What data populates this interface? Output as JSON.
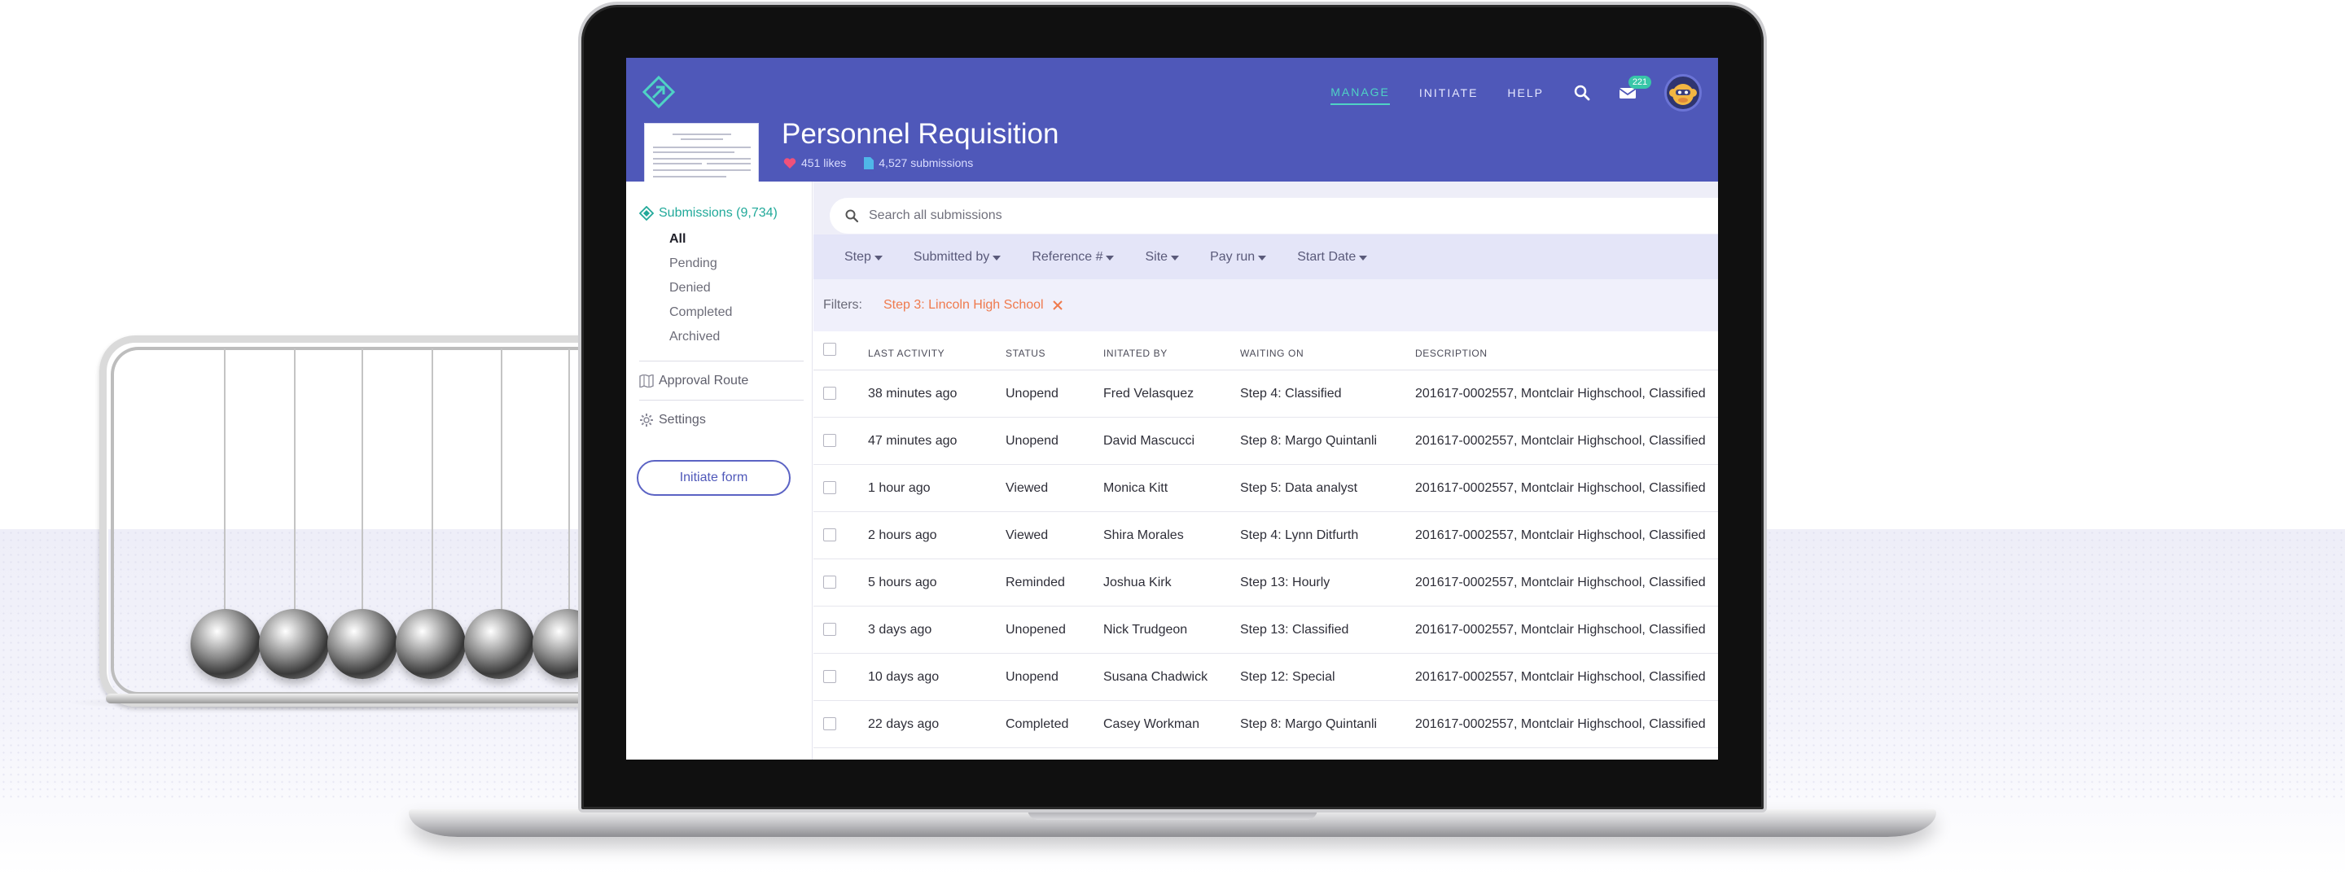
{
  "app": {
    "nav": {
      "manage": "MANAGE",
      "initiate": "INITIATE",
      "help": "HELP"
    },
    "mail_count": "221",
    "accent": "#4f58b9",
    "teal": "#21a99a",
    "filter_color": "#ef7a4d"
  },
  "form": {
    "title": "Personnel Requisition",
    "likes": "451 likes",
    "submissions": "4,527 submissions"
  },
  "sidebar": {
    "heading": "Submissions (9,734)",
    "subitems": [
      "All",
      "Pending",
      "Denied",
      "Completed",
      "Archived"
    ],
    "approval_route": "Approval Route",
    "settings": "Settings",
    "initiate_button": "Initiate form"
  },
  "search": {
    "placeholder": "Search all submissions"
  },
  "dropdowns": [
    "Step",
    "Submitted by",
    "Reference #",
    "Site",
    "Pay run",
    "Start Date"
  ],
  "filters": {
    "label": "Filters:",
    "active": "Step 3: Lincoln High School"
  },
  "table": {
    "headers": [
      "LAST ACTIVITY",
      "STATUS",
      "INITATED BY",
      "WAITING ON",
      "DESCRIPTION"
    ],
    "rows": [
      [
        "38 minutes ago",
        "Unopend",
        "Fred Velasquez",
        "Step 4: Classified",
        "201617-0002557, Montclair Highschool, Classified"
      ],
      [
        "47 minutes ago",
        "Unopend",
        "David Mascucci",
        "Step 8: Margo Quintanli",
        "201617-0002557, Montclair Highschool, Classified"
      ],
      [
        "1 hour ago",
        "Viewed",
        "Monica Kitt",
        "Step 5: Data analyst",
        "201617-0002557, Montclair Highschool, Classified"
      ],
      [
        "2 hours ago",
        "Viewed",
        "Shira Morales",
        "Step 4: Lynn Ditfurth",
        "201617-0002557, Montclair Highschool, Classified"
      ],
      [
        "5 hours ago",
        "Reminded",
        "Joshua Kirk",
        "Step 13: Hourly",
        "201617-0002557, Montclair Highschool, Classified"
      ],
      [
        "3 days ago",
        "Unopened",
        "Nick Trudgeon",
        "Step 13: Classified",
        "201617-0002557, Montclair Highschool, Classified"
      ],
      [
        "10 days ago",
        "Unopend",
        "Susana Chadwick",
        "Step 12: Special",
        "201617-0002557, Montclair Highschool, Classified"
      ],
      [
        "22 days ago",
        "Completed",
        "Casey Workman",
        "Step 8: Margo Quintanli",
        "201617-0002557, Montclair Highschool, Classified"
      ]
    ]
  }
}
